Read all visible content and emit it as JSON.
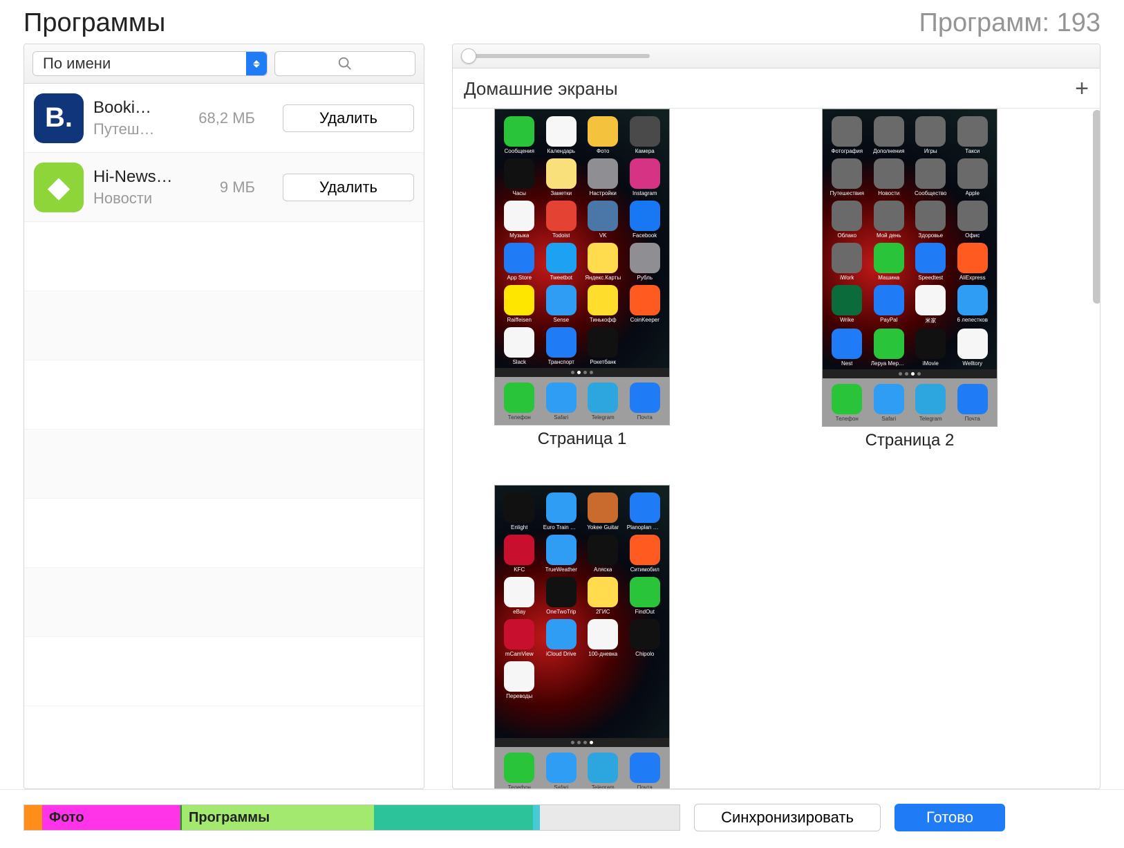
{
  "header": {
    "title": "Программы",
    "count_label": "Программ: 193"
  },
  "sort": {
    "label": "По имени"
  },
  "apps": [
    {
      "name": "Booki…",
      "category": "Путеш…",
      "size": "68,2 МБ",
      "delete_label": "Удалить",
      "icon_bg": "#10357a",
      "icon_text": "B."
    },
    {
      "name": "Hi-News…",
      "category": "Новости",
      "size": "9 МБ",
      "delete_label": "Удалить",
      "icon_bg": "#8ed53a",
      "icon_text": "◆"
    }
  ],
  "home": {
    "title": "Домашние экраны"
  },
  "page_labels": [
    "Страница 1",
    "Страница 2"
  ],
  "dock": [
    {
      "label": "Телефон",
      "bg": "#29c43a"
    },
    {
      "label": "Safari",
      "bg": "#2f9df4"
    },
    {
      "label": "Telegram",
      "bg": "#2da6e0"
    },
    {
      "label": "Почта",
      "bg": "#1f7cf6"
    }
  ],
  "screens": [
    [
      {
        "label": "Сообщения",
        "bg": "#29c43a"
      },
      {
        "label": "Календарь",
        "bg": "#f7f7f7"
      },
      {
        "label": "Фото",
        "bg": "#f4c23c"
      },
      {
        "label": "Камера",
        "bg": "#4a4a4a"
      },
      {
        "label": "Часы",
        "bg": "#111"
      },
      {
        "label": "Заметки",
        "bg": "#f9e07a"
      },
      {
        "label": "Настройки",
        "bg": "#8e8e93"
      },
      {
        "label": "Instagram",
        "bg": "#d63384"
      },
      {
        "label": "Музыка",
        "bg": "#f6f6f6"
      },
      {
        "label": "Todoist",
        "bg": "#e44232"
      },
      {
        "label": "VK",
        "bg": "#4a76a8"
      },
      {
        "label": "Facebook",
        "bg": "#1877f2"
      },
      {
        "label": "App Store",
        "bg": "#1f7cf6"
      },
      {
        "label": "Tweetbot",
        "bg": "#1da1f2"
      },
      {
        "label": "Яндекс.Карты",
        "bg": "#ffdb4d"
      },
      {
        "label": "Рубль",
        "bg": "#8e8e93"
      },
      {
        "label": "Raiffeisen",
        "bg": "#ffe600"
      },
      {
        "label": "Sense",
        "bg": "#2f9df4"
      },
      {
        "label": "Тинькофф",
        "bg": "#ffdd2d"
      },
      {
        "label": "CoinKeeper",
        "bg": "#ff5a1f"
      },
      {
        "label": "Slack",
        "bg": "#f6f6f6"
      },
      {
        "label": "Транспорт",
        "bg": "#1f7cf6"
      },
      {
        "label": "Рокетбанк",
        "bg": "#111"
      },
      {
        "label": "",
        "bg": "transparent"
      }
    ],
    [
      {
        "label": "Фотография",
        "bg": "#6a6a6a"
      },
      {
        "label": "Дополнения",
        "bg": "#6a6a6a"
      },
      {
        "label": "Игры",
        "bg": "#6a6a6a"
      },
      {
        "label": "Такси",
        "bg": "#6a6a6a"
      },
      {
        "label": "Путешествия",
        "bg": "#6a6a6a"
      },
      {
        "label": "Новости",
        "bg": "#6a6a6a"
      },
      {
        "label": "Сообщество",
        "bg": "#6a6a6a"
      },
      {
        "label": "Apple",
        "bg": "#6a6a6a"
      },
      {
        "label": "Облако",
        "bg": "#6a6a6a"
      },
      {
        "label": "Мой день",
        "bg": "#6a6a6a"
      },
      {
        "label": "Здоровье",
        "bg": "#6a6a6a"
      },
      {
        "label": "Офис",
        "bg": "#6a6a6a"
      },
      {
        "label": "iWork",
        "bg": "#6a6a6a"
      },
      {
        "label": "Машина",
        "bg": "#29c43a"
      },
      {
        "label": "Speedtest",
        "bg": "#1f7cf6"
      },
      {
        "label": "AliExpress",
        "bg": "#ff5a1f"
      },
      {
        "label": "Wrike",
        "bg": "#0b6b3a"
      },
      {
        "label": "PayPal",
        "bg": "#1f7cf6"
      },
      {
        "label": "米家",
        "bg": "#f6f6f6"
      },
      {
        "label": "6 лепестков",
        "bg": "#2f9df4"
      },
      {
        "label": "Nest",
        "bg": "#1f7cf6"
      },
      {
        "label": "Леруа Мерлен",
        "bg": "#29c43a"
      },
      {
        "label": "iMovie",
        "bg": "#111"
      },
      {
        "label": "Welltory",
        "bg": "#f6f6f6"
      }
    ],
    [
      {
        "label": "Enlight",
        "bg": "#111"
      },
      {
        "label": "Euro Train Sim",
        "bg": "#2f9df4"
      },
      {
        "label": "Yokee Guitar",
        "bg": "#c96b2f"
      },
      {
        "label": "Planoplan GO!",
        "bg": "#1f7cf6"
      },
      {
        "label": "KFC",
        "bg": "#c8102e"
      },
      {
        "label": "TrueWeather",
        "bg": "#2f9df4"
      },
      {
        "label": "Аляска",
        "bg": "#111"
      },
      {
        "label": "Ситимобил",
        "bg": "#ff5a1f"
      },
      {
        "label": "eBay",
        "bg": "#f6f6f6"
      },
      {
        "label": "OneTwoTrip",
        "bg": "#111"
      },
      {
        "label": "2ГИС",
        "bg": "#ffdb4d"
      },
      {
        "label": "FindOut",
        "bg": "#29c43a"
      },
      {
        "label": "mCamView",
        "bg": "#c8102e"
      },
      {
        "label": "iCloud Drive",
        "bg": "#2f9df4"
      },
      {
        "label": "100-дневка",
        "bg": "#f6f6f6"
      },
      {
        "label": "Chipolo",
        "bg": "#111"
      },
      {
        "label": "Переводы",
        "bg": "#f6f6f6"
      },
      {
        "label": "",
        "bg": "transparent"
      },
      {
        "label": "",
        "bg": "transparent"
      },
      {
        "label": "",
        "bg": "transparent"
      },
      {
        "label": "",
        "bg": "transparent"
      },
      {
        "label": "",
        "bg": "transparent"
      },
      {
        "label": "",
        "bg": "transparent"
      },
      {
        "label": "",
        "bg": "transparent"
      }
    ]
  ],
  "storage": {
    "photo_label": "Фото",
    "apps_label": "Программы"
  },
  "buttons": {
    "sync": "Синхронизировать",
    "done": "Готово"
  }
}
